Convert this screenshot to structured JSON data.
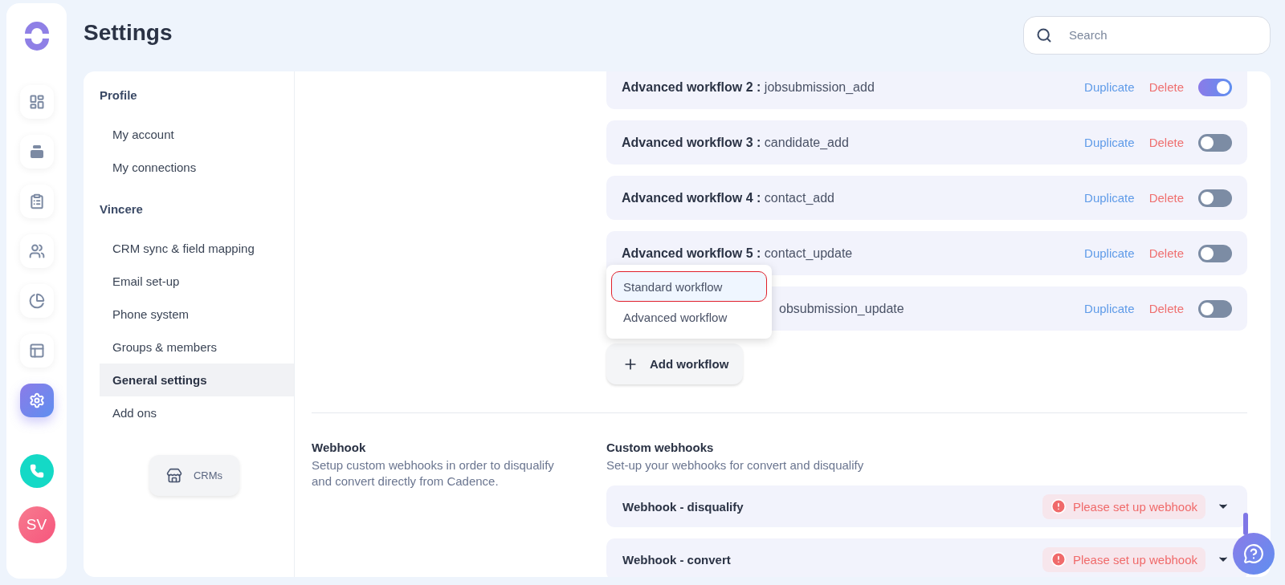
{
  "header": {
    "title": "Settings",
    "search": {
      "placeholder": "Search"
    }
  },
  "nav": [
    {
      "kind": "dashboard",
      "selected": false
    },
    {
      "kind": "stack",
      "selected": false
    },
    {
      "kind": "tasks",
      "selected": false
    },
    {
      "kind": "people",
      "selected": false
    },
    {
      "kind": "reports",
      "selected": false
    },
    {
      "kind": "layout",
      "selected": false
    },
    {
      "kind": "settings",
      "selected": true
    }
  ],
  "avatar": {
    "initials": "SV"
  },
  "sidebar": {
    "groups": [
      {
        "title": "Profile",
        "items": [
          {
            "label": "My account",
            "selected": false
          },
          {
            "label": "My connections",
            "selected": false
          }
        ]
      },
      {
        "title": "Vincere",
        "items": [
          {
            "label": "CRM sync & field mapping",
            "selected": false
          },
          {
            "label": "Email set-up",
            "selected": false
          },
          {
            "label": "Phone system",
            "selected": false
          },
          {
            "label": "Groups & members",
            "selected": false
          },
          {
            "label": "General settings",
            "selected": true
          },
          {
            "label": "Add ons",
            "selected": false
          }
        ]
      }
    ],
    "crm_button": "CRMs"
  },
  "workflows": [
    {
      "title": "Advanced workflow 2 :",
      "name": "jobsubmission_add",
      "duplicate": "Duplicate",
      "delete": "Delete",
      "on": true
    },
    {
      "title": "Advanced workflow 3 :",
      "name": "candidate_add",
      "duplicate": "Duplicate",
      "delete": "Delete",
      "on": false
    },
    {
      "title": "Advanced workflow 4 :",
      "name": "contact_add",
      "duplicate": "Duplicate",
      "delete": "Delete",
      "on": false
    },
    {
      "title": "Advanced workflow 5 :",
      "name": "contact_update",
      "duplicate": "Duplicate",
      "delete": "Delete",
      "on": false
    },
    {
      "name": "obsubmission_update",
      "duplicate": "Duplicate",
      "delete": "Delete",
      "on": false
    }
  ],
  "add_menu": [
    {
      "label": "Standard workflow",
      "selected": true
    },
    {
      "label": "Advanced workflow",
      "selected": false
    }
  ],
  "add_button": "Add workflow",
  "webhook": {
    "title": "Webhook",
    "description": "Setup custom webhooks in order to disqualify and convert directly from Cadence.",
    "heading": "Custom webhooks",
    "subheading": "Set-up your webhooks for convert and disqualify",
    "items": [
      {
        "name": "Webhook - disqualify",
        "status": "Please set up webhook"
      },
      {
        "name": "Webhook - convert",
        "status": "Please set up webhook"
      }
    ]
  }
}
